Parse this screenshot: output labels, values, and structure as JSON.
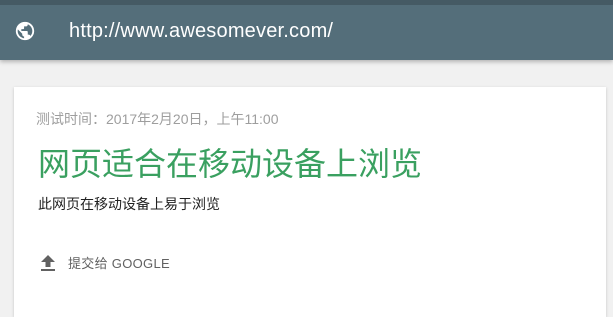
{
  "address_bar": {
    "url": "http://www.awesomever.com/",
    "icon": "globe-icon"
  },
  "result_card": {
    "timestamp": "测试时间：2017年2月20日，上午11:00",
    "headline": "网页适合在移动设备上浏览",
    "description": "此网页在移动设备上易于浏览",
    "submit_label": "提交给 GOOGLE",
    "submit_icon": "upload-icon"
  },
  "colors": {
    "topbar": "#546e7a",
    "headline": "#3aa060",
    "background": "#f1f1f1"
  }
}
